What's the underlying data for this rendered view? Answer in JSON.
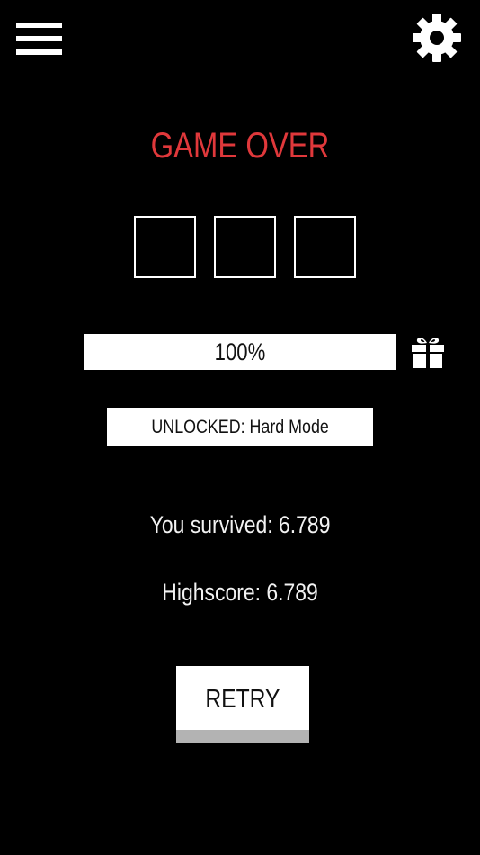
{
  "header": {
    "menu_icon": "hamburger-menu-icon",
    "settings_icon": "gear-icon"
  },
  "title": "GAME OVER",
  "slots": [
    {
      "filled": false
    },
    {
      "filled": false
    },
    {
      "filled": false
    }
  ],
  "progress": {
    "value": 100,
    "label": "100%",
    "gift_icon": "gift-icon"
  },
  "unlocked_text": "UNLOCKED: Hard Mode",
  "stats": {
    "survived": "You survived: 6.789",
    "highscore": "Highscore: 6.789"
  },
  "retry_label": "RETRY",
  "colors": {
    "background": "#000000",
    "title": "#e0383b",
    "foreground": "#ffffff",
    "button_shadow": "#b3b3b3"
  }
}
